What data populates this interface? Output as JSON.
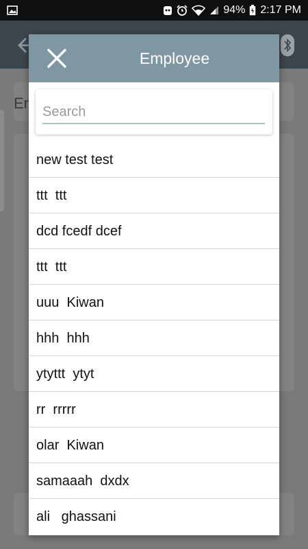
{
  "status_bar": {
    "battery": "94%",
    "time": "2:17 PM",
    "icons": [
      "image-icon",
      "notification-icon",
      "alarm-icon",
      "wifi-icon",
      "signal-icon",
      "battery-icon"
    ]
  },
  "background": {
    "label": "En",
    "icons": [
      "back-arrow-icon",
      "bluetooth-icon"
    ]
  },
  "dialog": {
    "title": "Employee",
    "close_icon": "close-icon",
    "search_placeholder": "Search",
    "header_color": "#7f96a3",
    "employees": [
      "new test test",
      "ttt  ttt",
      "dcd fcedf dcef",
      "ttt  ttt",
      "uuu  Kiwan",
      "hhh  hhh",
      "ytyttt  ytyt",
      "rr  rrrrr",
      "olar  Kiwan",
      "samaaah  dxdx",
      "ali   ghassani"
    ]
  }
}
